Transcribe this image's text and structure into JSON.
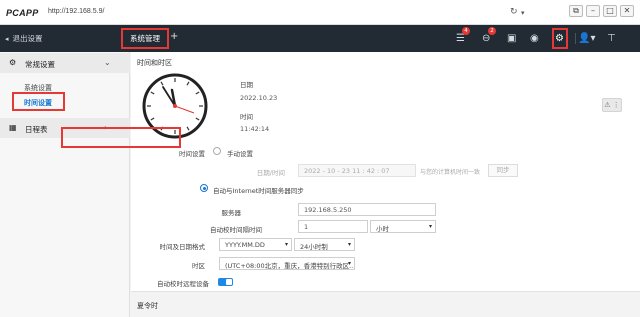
{
  "titlebar": {
    "app_name": "PCAPP",
    "url": "http://192.168.5.9/",
    "refresh_icon": "refresh-icon",
    "dropdown_icon": "chevron-down-icon",
    "window_controls": [
      "⧉",
      "–",
      "□",
      "✕"
    ]
  },
  "navbar": {
    "logout_label": "退出设置",
    "active_tab": "系统管理",
    "add_tab": "+",
    "icons": {
      "alarm_list_badge": "4",
      "search_badge": "2"
    }
  },
  "sidebar": {
    "general": {
      "label": "常规设置",
      "items": [
        "系统设置",
        "时间设置"
      ]
    },
    "schedule": {
      "label": "日程表"
    }
  },
  "main": {
    "time_zone_section": "时间和时区",
    "date_label": "日期",
    "date_value": "2022.10.23",
    "time_label": "时间",
    "time_value": "11:42:14",
    "time_setting_label": "时间设置",
    "manual_label": "手动设置",
    "datetime_label": "日期/时间",
    "datetime_value": "2022 - 10 - 23   11 : 42 : 07",
    "sync_hint": "与您的计算机时间一致",
    "sync_button": "同步",
    "ntp_label": "自动与Internet时间服务器同步",
    "server_label": "服务器",
    "server_value": "192.168.5.250",
    "interval_label": "自动校时间隔时间",
    "interval_value": "1",
    "interval_unit": "小时",
    "format_label": "时间及日期格式",
    "date_format": "YYYY.MM.DD",
    "hour_format": "24小时制",
    "timezone_label": "时区",
    "timezone_value": "(UTC+08:00北京，重庆，香港特别行政区...",
    "auto_sync_label": "自动校时远程设备",
    "dst_section": "夏令时"
  }
}
